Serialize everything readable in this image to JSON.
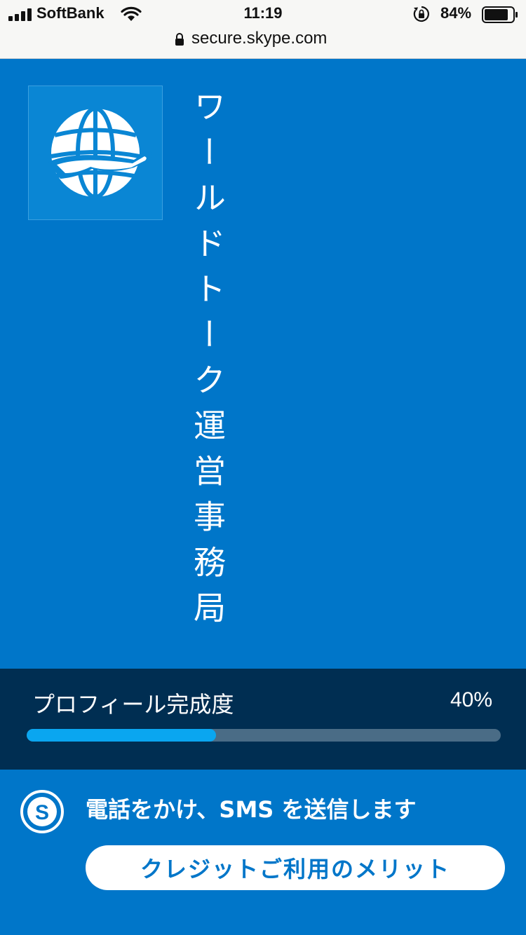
{
  "status_bar": {
    "carrier": "SoftBank",
    "time": "11:19",
    "battery": "84%",
    "battery_level": 0.84
  },
  "url_bar": {
    "url": "secure.skype.com"
  },
  "profile": {
    "name": "ワールドトーク運営事務局",
    "avatar_icon": "globe-with-plane-icon"
  },
  "completion": {
    "label": "プロフィール完成度",
    "percent_text": "40%",
    "percent_value": 40
  },
  "promo": {
    "text": "電話をかけ、SMS を送信します",
    "button_label": "クレジットご利用のメリット",
    "logo_icon": "skype-icon"
  },
  "colors": {
    "brand_blue": "#0076c9",
    "panel_dark": "#002e52",
    "progress_fill": "#0aa6f0",
    "progress_track": "#4a6c86"
  }
}
